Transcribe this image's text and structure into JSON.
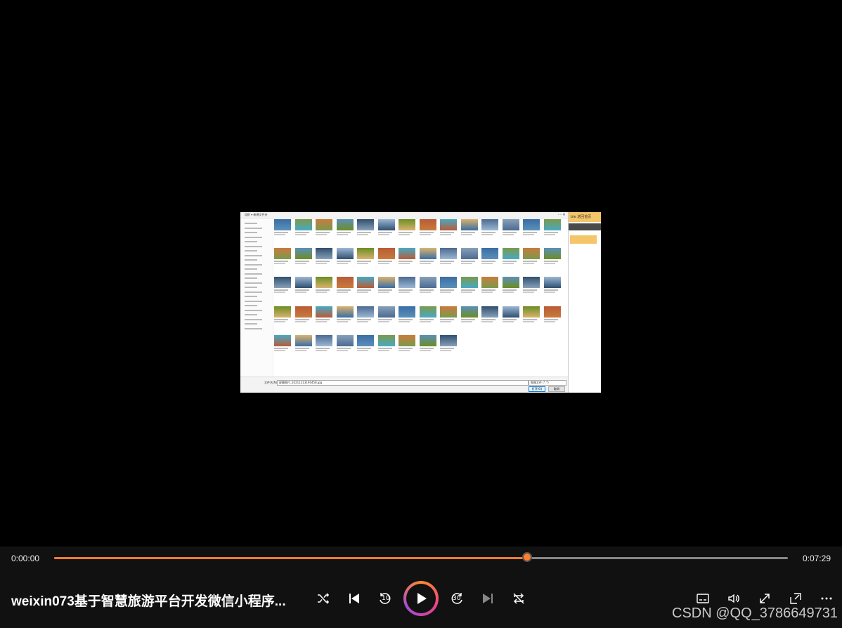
{
  "player": {
    "title": "weixin073基于智慧旅游平台开发微信小程序...",
    "current_time": "0:00:00",
    "duration": "0:07:29",
    "progress_fraction": 0.645,
    "accent_color": "#ff7d2e"
  },
  "controls": {
    "shuffle_icon": "shuffle-icon",
    "previous_icon": "skip-previous-icon",
    "rewind_seconds": "10",
    "play_icon": "play-icon",
    "forward_seconds": "30",
    "next_icon": "skip-next-icon",
    "repeat_icon": "repeat-off-icon",
    "subtitles_icon": "subtitles-icon",
    "volume_icon": "volume-icon",
    "fullscreen_icon": "fullscreen-icon",
    "miniplayer_icon": "miniplayer-icon",
    "more_icon": "more-icon"
  },
  "watermark": "CSDN @QQ_3786649731",
  "video_frame": {
    "dialog_breadcrumb": "组织 ▾   新建文件夹",
    "filename_label": "文件名(N):",
    "filename_value": "屏幕图片_20211213190458.jpg",
    "filetype_value": "图像文件 (*.*)",
    "open_button": "打开(O)",
    "cancel_button": "取消",
    "right_panel_title": "ble   返回首页"
  }
}
